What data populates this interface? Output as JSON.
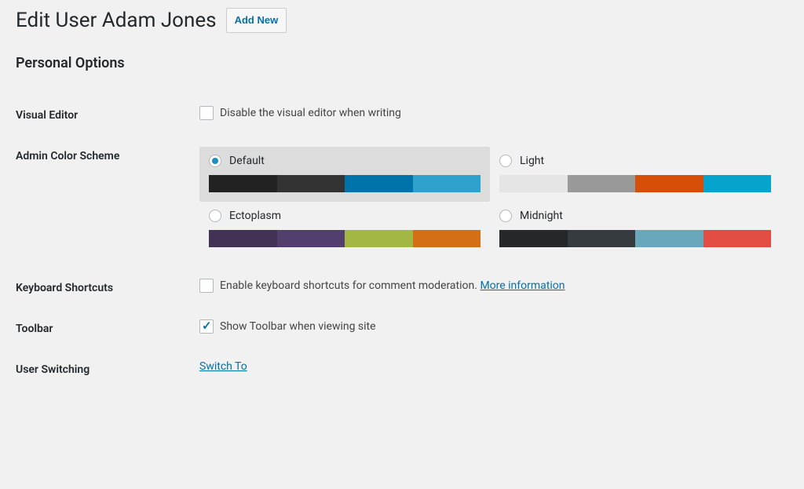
{
  "header": {
    "title": "Edit User Adam Jones",
    "add_new": "Add New"
  },
  "section_heading": "Personal Options",
  "visual_editor": {
    "label": "Visual Editor",
    "checkbox_label": "Disable the visual editor when writing",
    "checked": false
  },
  "admin_color_scheme": {
    "label": "Admin Color Scheme",
    "selected": "default",
    "options": [
      {
        "id": "default",
        "name": "Default",
        "colors": [
          "#222222",
          "#333333",
          "#0073aa",
          "#2ea2cc"
        ]
      },
      {
        "id": "light",
        "name": "Light",
        "colors": [
          "#e5e5e5",
          "#999999",
          "#d64e07",
          "#04a4cc"
        ]
      },
      {
        "id": "ectoplasm",
        "name": "Ectoplasm",
        "colors": [
          "#413256",
          "#523f6d",
          "#a3b745",
          "#d46f15"
        ]
      },
      {
        "id": "midnight",
        "name": "Midnight",
        "colors": [
          "#25282b",
          "#363b3f",
          "#69a8bb",
          "#e14d43"
        ]
      }
    ]
  },
  "keyboard_shortcuts": {
    "label": "Keyboard Shortcuts",
    "checkbox_label": "Enable keyboard shortcuts for comment moderation.",
    "more_info": "More information",
    "checked": false
  },
  "toolbar": {
    "label": "Toolbar",
    "checkbox_label": "Show Toolbar when viewing site",
    "checked": true
  },
  "user_switching": {
    "label": "User Switching",
    "link_text": "Switch To"
  }
}
